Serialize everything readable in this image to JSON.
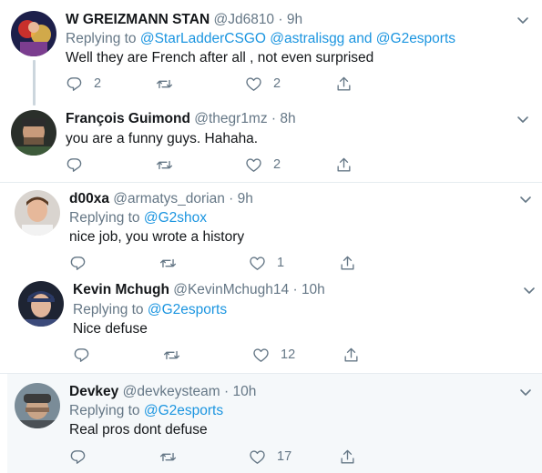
{
  "tweets": [
    {
      "name": "W GREIZMANN STAN",
      "handle": "@Jd6810",
      "dot": "·",
      "time": "9h",
      "replying_prefix": "Replying to",
      "mentions": "@StarLadderCSGO @astralisgg and @G2esports",
      "text": "Well they are French after all , not even surprised",
      "reply_count": "2",
      "retweet_count": "",
      "like_count": "2"
    },
    {
      "name": "François Guimond",
      "handle": "@thegr1mz",
      "dot": "·",
      "time": "8h",
      "text": "you are a funny guys. Hahaha.",
      "reply_count": "",
      "retweet_count": "",
      "like_count": "2"
    },
    {
      "name": "d00xa",
      "handle": "@armatys_dorian",
      "dot": "·",
      "time": "9h",
      "replying_prefix": "Replying to",
      "mentions": "@G2shox",
      "text": "nice job, you wrote a history",
      "reply_count": "",
      "retweet_count": "",
      "like_count": "1"
    },
    {
      "name": "Kevin Mchugh",
      "handle": "@KevinMchugh14",
      "dot": "·",
      "time": "10h",
      "replying_prefix": "Replying to",
      "mentions": "@G2esports",
      "text": "Nice defuse",
      "reply_count": "",
      "retweet_count": "",
      "like_count": "12"
    },
    {
      "name": "Devkey",
      "handle": "@devkeysteam",
      "dot": "·",
      "time": "10h",
      "replying_prefix": "Replying to",
      "mentions": "@G2esports",
      "text": "Real pros dont defuse",
      "reply_count": "",
      "retweet_count": "",
      "like_count": "17"
    }
  ],
  "icons": {
    "reply": "reply-icon",
    "retweet": "retweet-icon",
    "like": "heart-icon",
    "share": "share-icon",
    "more": "chevron-down-icon"
  },
  "colors": {
    "link": "#1b95e0",
    "secondary": "#657786",
    "text": "#14171a",
    "divider": "#e6ecf0",
    "highlight": "#f5f8fa"
  }
}
